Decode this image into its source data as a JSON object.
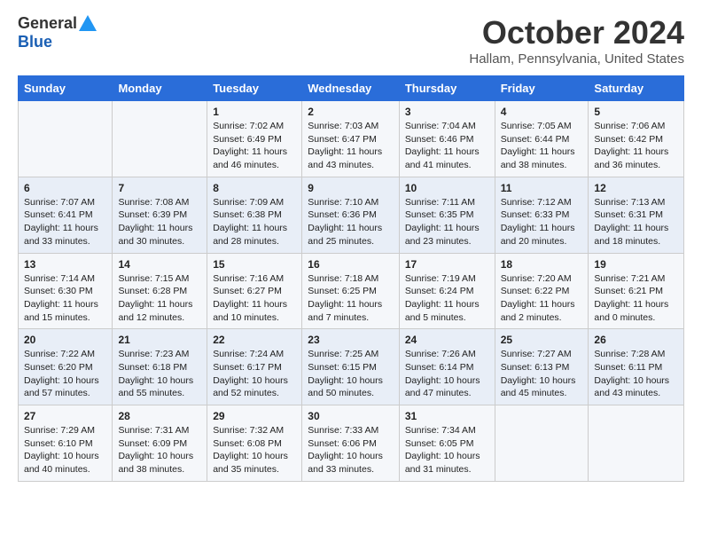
{
  "header": {
    "logo": {
      "general": "General",
      "blue": "Blue"
    },
    "title": "October 2024",
    "location": "Hallam, Pennsylvania, United States"
  },
  "weekdays": [
    "Sunday",
    "Monday",
    "Tuesday",
    "Wednesday",
    "Thursday",
    "Friday",
    "Saturday"
  ],
  "weeks": [
    [
      {
        "day": "",
        "sunrise": "",
        "sunset": "",
        "daylight": ""
      },
      {
        "day": "",
        "sunrise": "",
        "sunset": "",
        "daylight": ""
      },
      {
        "day": "1",
        "sunrise": "Sunrise: 7:02 AM",
        "sunset": "Sunset: 6:49 PM",
        "daylight": "Daylight: 11 hours and 46 minutes."
      },
      {
        "day": "2",
        "sunrise": "Sunrise: 7:03 AM",
        "sunset": "Sunset: 6:47 PM",
        "daylight": "Daylight: 11 hours and 43 minutes."
      },
      {
        "day": "3",
        "sunrise": "Sunrise: 7:04 AM",
        "sunset": "Sunset: 6:46 PM",
        "daylight": "Daylight: 11 hours and 41 minutes."
      },
      {
        "day": "4",
        "sunrise": "Sunrise: 7:05 AM",
        "sunset": "Sunset: 6:44 PM",
        "daylight": "Daylight: 11 hours and 38 minutes."
      },
      {
        "day": "5",
        "sunrise": "Sunrise: 7:06 AM",
        "sunset": "Sunset: 6:42 PM",
        "daylight": "Daylight: 11 hours and 36 minutes."
      }
    ],
    [
      {
        "day": "6",
        "sunrise": "Sunrise: 7:07 AM",
        "sunset": "Sunset: 6:41 PM",
        "daylight": "Daylight: 11 hours and 33 minutes."
      },
      {
        "day": "7",
        "sunrise": "Sunrise: 7:08 AM",
        "sunset": "Sunset: 6:39 PM",
        "daylight": "Daylight: 11 hours and 30 minutes."
      },
      {
        "day": "8",
        "sunrise": "Sunrise: 7:09 AM",
        "sunset": "Sunset: 6:38 PM",
        "daylight": "Daylight: 11 hours and 28 minutes."
      },
      {
        "day": "9",
        "sunrise": "Sunrise: 7:10 AM",
        "sunset": "Sunset: 6:36 PM",
        "daylight": "Daylight: 11 hours and 25 minutes."
      },
      {
        "day": "10",
        "sunrise": "Sunrise: 7:11 AM",
        "sunset": "Sunset: 6:35 PM",
        "daylight": "Daylight: 11 hours and 23 minutes."
      },
      {
        "day": "11",
        "sunrise": "Sunrise: 7:12 AM",
        "sunset": "Sunset: 6:33 PM",
        "daylight": "Daylight: 11 hours and 20 minutes."
      },
      {
        "day": "12",
        "sunrise": "Sunrise: 7:13 AM",
        "sunset": "Sunset: 6:31 PM",
        "daylight": "Daylight: 11 hours and 18 minutes."
      }
    ],
    [
      {
        "day": "13",
        "sunrise": "Sunrise: 7:14 AM",
        "sunset": "Sunset: 6:30 PM",
        "daylight": "Daylight: 11 hours and 15 minutes."
      },
      {
        "day": "14",
        "sunrise": "Sunrise: 7:15 AM",
        "sunset": "Sunset: 6:28 PM",
        "daylight": "Daylight: 11 hours and 12 minutes."
      },
      {
        "day": "15",
        "sunrise": "Sunrise: 7:16 AM",
        "sunset": "Sunset: 6:27 PM",
        "daylight": "Daylight: 11 hours and 10 minutes."
      },
      {
        "day": "16",
        "sunrise": "Sunrise: 7:18 AM",
        "sunset": "Sunset: 6:25 PM",
        "daylight": "Daylight: 11 hours and 7 minutes."
      },
      {
        "day": "17",
        "sunrise": "Sunrise: 7:19 AM",
        "sunset": "Sunset: 6:24 PM",
        "daylight": "Daylight: 11 hours and 5 minutes."
      },
      {
        "day": "18",
        "sunrise": "Sunrise: 7:20 AM",
        "sunset": "Sunset: 6:22 PM",
        "daylight": "Daylight: 11 hours and 2 minutes."
      },
      {
        "day": "19",
        "sunrise": "Sunrise: 7:21 AM",
        "sunset": "Sunset: 6:21 PM",
        "daylight": "Daylight: 11 hours and 0 minutes."
      }
    ],
    [
      {
        "day": "20",
        "sunrise": "Sunrise: 7:22 AM",
        "sunset": "Sunset: 6:20 PM",
        "daylight": "Daylight: 10 hours and 57 minutes."
      },
      {
        "day": "21",
        "sunrise": "Sunrise: 7:23 AM",
        "sunset": "Sunset: 6:18 PM",
        "daylight": "Daylight: 10 hours and 55 minutes."
      },
      {
        "day": "22",
        "sunrise": "Sunrise: 7:24 AM",
        "sunset": "Sunset: 6:17 PM",
        "daylight": "Daylight: 10 hours and 52 minutes."
      },
      {
        "day": "23",
        "sunrise": "Sunrise: 7:25 AM",
        "sunset": "Sunset: 6:15 PM",
        "daylight": "Daylight: 10 hours and 50 minutes."
      },
      {
        "day": "24",
        "sunrise": "Sunrise: 7:26 AM",
        "sunset": "Sunset: 6:14 PM",
        "daylight": "Daylight: 10 hours and 47 minutes."
      },
      {
        "day": "25",
        "sunrise": "Sunrise: 7:27 AM",
        "sunset": "Sunset: 6:13 PM",
        "daylight": "Daylight: 10 hours and 45 minutes."
      },
      {
        "day": "26",
        "sunrise": "Sunrise: 7:28 AM",
        "sunset": "Sunset: 6:11 PM",
        "daylight": "Daylight: 10 hours and 43 minutes."
      }
    ],
    [
      {
        "day": "27",
        "sunrise": "Sunrise: 7:29 AM",
        "sunset": "Sunset: 6:10 PM",
        "daylight": "Daylight: 10 hours and 40 minutes."
      },
      {
        "day": "28",
        "sunrise": "Sunrise: 7:31 AM",
        "sunset": "Sunset: 6:09 PM",
        "daylight": "Daylight: 10 hours and 38 minutes."
      },
      {
        "day": "29",
        "sunrise": "Sunrise: 7:32 AM",
        "sunset": "Sunset: 6:08 PM",
        "daylight": "Daylight: 10 hours and 35 minutes."
      },
      {
        "day": "30",
        "sunrise": "Sunrise: 7:33 AM",
        "sunset": "Sunset: 6:06 PM",
        "daylight": "Daylight: 10 hours and 33 minutes."
      },
      {
        "day": "31",
        "sunrise": "Sunrise: 7:34 AM",
        "sunset": "Sunset: 6:05 PM",
        "daylight": "Daylight: 10 hours and 31 minutes."
      },
      {
        "day": "",
        "sunrise": "",
        "sunset": "",
        "daylight": ""
      },
      {
        "day": "",
        "sunrise": "",
        "sunset": "",
        "daylight": ""
      }
    ]
  ]
}
